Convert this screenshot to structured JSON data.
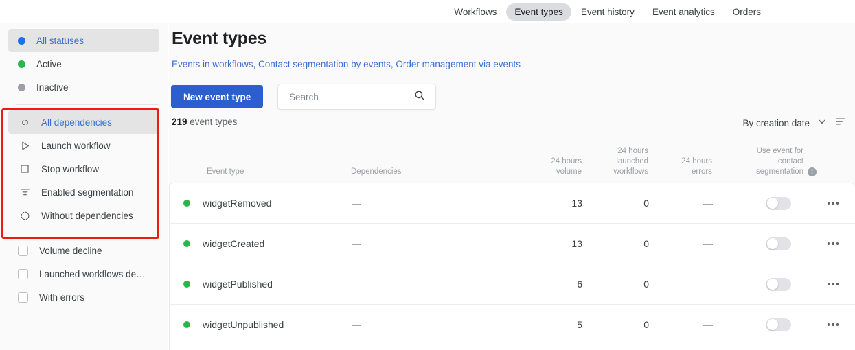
{
  "topnav": {
    "items": [
      {
        "label": "Workflows",
        "active": false
      },
      {
        "label": "Event types",
        "active": true
      },
      {
        "label": "Event history",
        "active": false
      },
      {
        "label": "Event analytics",
        "active": false
      },
      {
        "label": "Orders",
        "active": false
      }
    ]
  },
  "sidebar": {
    "statuses": [
      {
        "label": "All statuses",
        "dot": "blue-dot",
        "color": "#1a73e8",
        "selected": true
      },
      {
        "label": "Active",
        "dot": "green-dot",
        "color": "#2bb54a",
        "selected": false
      },
      {
        "label": "Inactive",
        "dot": "gray-dot",
        "color": "#9aa0a6",
        "selected": false
      }
    ],
    "dependencies": [
      {
        "label": "All dependencies",
        "icon": "link-icon",
        "selected": true
      },
      {
        "label": "Launch workflow",
        "icon": "play-icon",
        "selected": false
      },
      {
        "label": "Stop workflow",
        "icon": "stop-square-icon",
        "selected": false
      },
      {
        "label": "Enabled segmentation",
        "icon": "funnel-icon",
        "selected": false
      },
      {
        "label": "Without dependencies",
        "icon": "dashed-circle-icon",
        "selected": false
      }
    ],
    "checkboxes": [
      {
        "label": "Volume decline",
        "checked": false
      },
      {
        "label": "Launched workflows de…",
        "checked": false
      },
      {
        "label": "With errors",
        "checked": false
      }
    ]
  },
  "main": {
    "title": "Event types",
    "sublinks": "Events in workflows, Contact segmentation by events, Order management via events",
    "new_button": "New event type",
    "search": {
      "value": "",
      "placeholder": "Search"
    },
    "count_number": "219",
    "count_label": "event types",
    "sort_label": "By creation date"
  },
  "table": {
    "headers": {
      "event_type": "Event type",
      "dependencies": "Dependencies",
      "volume_l1": "24 hours",
      "volume_l2": "volume",
      "launched_l1": "24 hours",
      "launched_l2": "launched",
      "launched_l3": "workflows",
      "errors_l1": "24 hours",
      "errors_l2": "errors",
      "segmentation_l1": "Use event for",
      "segmentation_l2": "contact",
      "segmentation_l3": "segmentation"
    },
    "rows": [
      {
        "status": "active",
        "name": "widgetRemoved",
        "dependencies": "—",
        "volume": "13",
        "launched": "0",
        "errors": "—",
        "toggle": false
      },
      {
        "status": "active",
        "name": "widgetCreated",
        "dependencies": "—",
        "volume": "13",
        "launched": "0",
        "errors": "—",
        "toggle": false
      },
      {
        "status": "active",
        "name": "widgetPublished",
        "dependencies": "—",
        "volume": "6",
        "launched": "0",
        "errors": "—",
        "toggle": false
      },
      {
        "status": "active",
        "name": "widgetUnpublished",
        "dependencies": "—",
        "volume": "5",
        "launched": "0",
        "errors": "—",
        "toggle": false
      }
    ]
  },
  "annotation": {
    "highlight_color": "#f01b0f"
  }
}
